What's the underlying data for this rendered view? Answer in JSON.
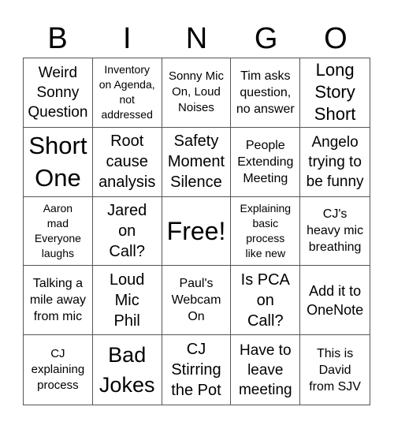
{
  "header": {
    "letters": [
      "B",
      "I",
      "N",
      "G",
      "O"
    ]
  },
  "cells": [
    {
      "text": "Weird\nSonny\nQuestion",
      "size": "s19"
    },
    {
      "text": "Inventory\non Agenda,\nnot\naddressed",
      "size": "s14"
    },
    {
      "text": "Sonny Mic\nOn, Loud\nNoises",
      "size": "s15"
    },
    {
      "text": "Tim asks\nquestion,\nno answer",
      "size": "s16"
    },
    {
      "text": "Long\nStory\nShort",
      "size": "s22"
    },
    {
      "text": "Short\nOne",
      "size": "s30"
    },
    {
      "text": "Root\ncause\nanalysis",
      "size": "s20"
    },
    {
      "text": "Safety\nMoment\nSilence",
      "size": "s20"
    },
    {
      "text": "People\nExtending\nMeeting",
      "size": "s16"
    },
    {
      "text": "Angelo\ntrying to\nbe funny",
      "size": "s19"
    },
    {
      "text": "Aaron\nmad\nEveryone\nlaughs",
      "size": "s14"
    },
    {
      "text": "Jared\non\nCall?",
      "size": "s20"
    },
    {
      "text": "Free!",
      "size": "s32"
    },
    {
      "text": "Explaining\nbasic\nprocess\nlike new",
      "size": "s14"
    },
    {
      "text": "CJ's\nheavy mic\nbreathing",
      "size": "s16"
    },
    {
      "text": "Talking a\nmile away\nfrom mic",
      "size": "s16"
    },
    {
      "text": "Loud\nMic\nPhil",
      "size": "s20"
    },
    {
      "text": "Paul's\nWebcam\nOn",
      "size": "s16"
    },
    {
      "text": "Is PCA\non\nCall?",
      "size": "s20"
    },
    {
      "text": "Add it to\nOneNote",
      "size": "s18"
    },
    {
      "text": "CJ\nexplaining\nprocess",
      "size": "s15"
    },
    {
      "text": "Bad\nJokes",
      "size": "s27"
    },
    {
      "text": "CJ\nStirring\nthe Pot",
      "size": "s20"
    },
    {
      "text": "Have to\nleave\nmeeting",
      "size": "s19"
    },
    {
      "text": "This is\nDavid\nfrom SJV",
      "size": "s16"
    }
  ]
}
